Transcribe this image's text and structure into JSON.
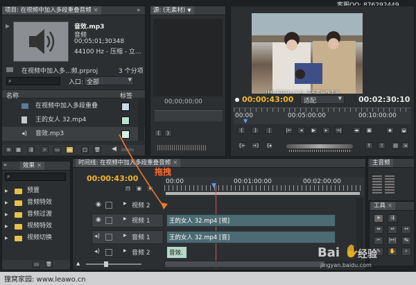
{
  "watermark_top": "客服QQ: 876292449",
  "project_panel": {
    "tab_label": "项目: 在视频中加入多段重叠音频",
    "preview": {
      "filename": "音效.mp3",
      "type": "音频",
      "duration": "00;05;01;30348",
      "specs": "44100 Hz - 压缩 - 立..."
    },
    "project_file": "在视频中加入多...频.prproj",
    "item_count": "3 个分项",
    "entry_label": "入口:",
    "entry_value": "全部",
    "col_name": "名称",
    "col_label": "标签",
    "items": [
      {
        "name": "在视频中加入多段重叠",
        "icon": "sequence-icon",
        "swatch": "#c5d9e6"
      },
      {
        "name": "王的女人 32.mp4",
        "icon": "video-file-icon",
        "swatch": "#bfe0d0"
      },
      {
        "name": "音效.mp3",
        "icon": "audio-file-icon",
        "swatch": "#d6f0e2"
      }
    ]
  },
  "source_panel": {
    "tab_label": "源: (无素材)",
    "timecode": "00;00;00;00"
  },
  "program_panel": {
    "timecode_current": "00:00:43:00",
    "fit_label": "适配",
    "timecode_duration": "00:02:30:10",
    "ruler": [
      "00:00",
      "00:05:00:00",
      "00:10:00:00"
    ],
    "subtitle": "让你不要自以为是 更不要自作主张"
  },
  "effects_panel": {
    "tab_label": "效果",
    "folders": [
      "预置",
      "音频特效",
      "音频过渡",
      "视频特效",
      "视频切换"
    ]
  },
  "timeline_panel": {
    "tab_label": "时间线: 在视频中加入多段重叠音频",
    "timecode": "00:00:43:00",
    "ruler": [
      "00:00",
      "00:01:00:00",
      "00:02:00:00"
    ],
    "annotation": "拖拽",
    "tracks": [
      {
        "name": "视频 2",
        "kind": "video",
        "clip": ""
      },
      {
        "name": "视频 1",
        "kind": "video",
        "clip": "王的女人 32.mp4 [视]"
      },
      {
        "name": "音频 1",
        "kind": "audio",
        "clip": "王的女人 32.mp4 [音]"
      },
      {
        "name": "音频 2",
        "kind": "audio",
        "clip": "音效."
      }
    ]
  },
  "master_panel": {
    "tab_label": "主音频"
  },
  "tools_panel": {
    "tab_label": "工具"
  },
  "footer": "狸窝家园: www.leawo.cn",
  "baidu_brand": "Bai",
  "baidu_suffix": "经验",
  "baidu_url": "jingyan.baidu.com"
}
